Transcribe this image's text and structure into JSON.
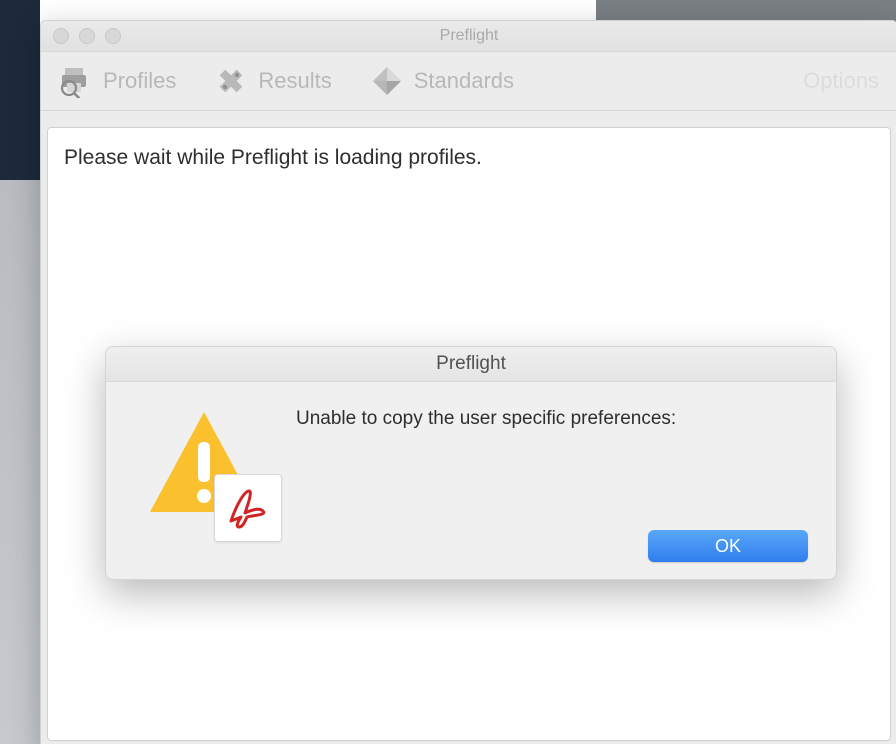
{
  "window": {
    "title": "Preflight"
  },
  "toolbar": {
    "profiles_label": "Profiles",
    "results_label": "Results",
    "standards_label": "Standards",
    "options_label": "Options"
  },
  "content": {
    "loading_message": "Please wait while Preflight is loading profiles."
  },
  "alert": {
    "title": "Preflight",
    "message": "Unable to copy the user specific preferences:",
    "ok_label": "OK"
  }
}
